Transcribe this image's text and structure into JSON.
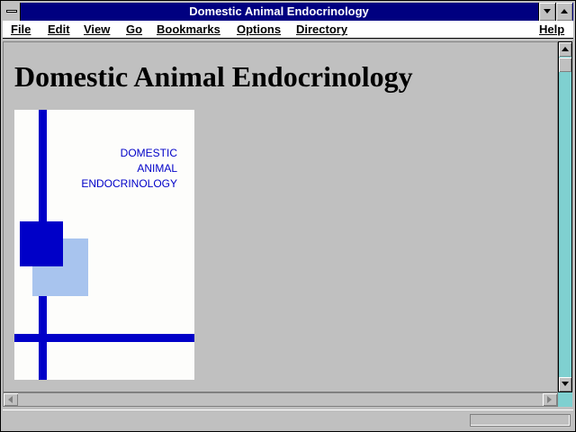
{
  "window": {
    "title": "Domestic Animal Endocrinology",
    "titlebar_color": "#000080"
  },
  "menu": {
    "items": [
      "File",
      "Edit",
      "View",
      "Go",
      "Bookmarks",
      "Options",
      "Directory"
    ],
    "help": "Help"
  },
  "page": {
    "heading": "Domestic Animal Endocrinology",
    "cover": {
      "lines": [
        "DOMESTIC",
        "ANIMAL",
        "ENDOCRINOLOGY"
      ],
      "accent_color": "#0000c8",
      "light_color": "#a8c4ee"
    }
  },
  "status": {
    "text": ""
  },
  "icons": {
    "system_menu": "system-menu-icon",
    "minimize": "minimize-icon",
    "maximize": "maximize-icon",
    "scroll_up": "scroll-up-icon",
    "scroll_down": "scroll-down-icon",
    "scroll_left": "scroll-left-icon",
    "scroll_right": "scroll-right-icon"
  }
}
